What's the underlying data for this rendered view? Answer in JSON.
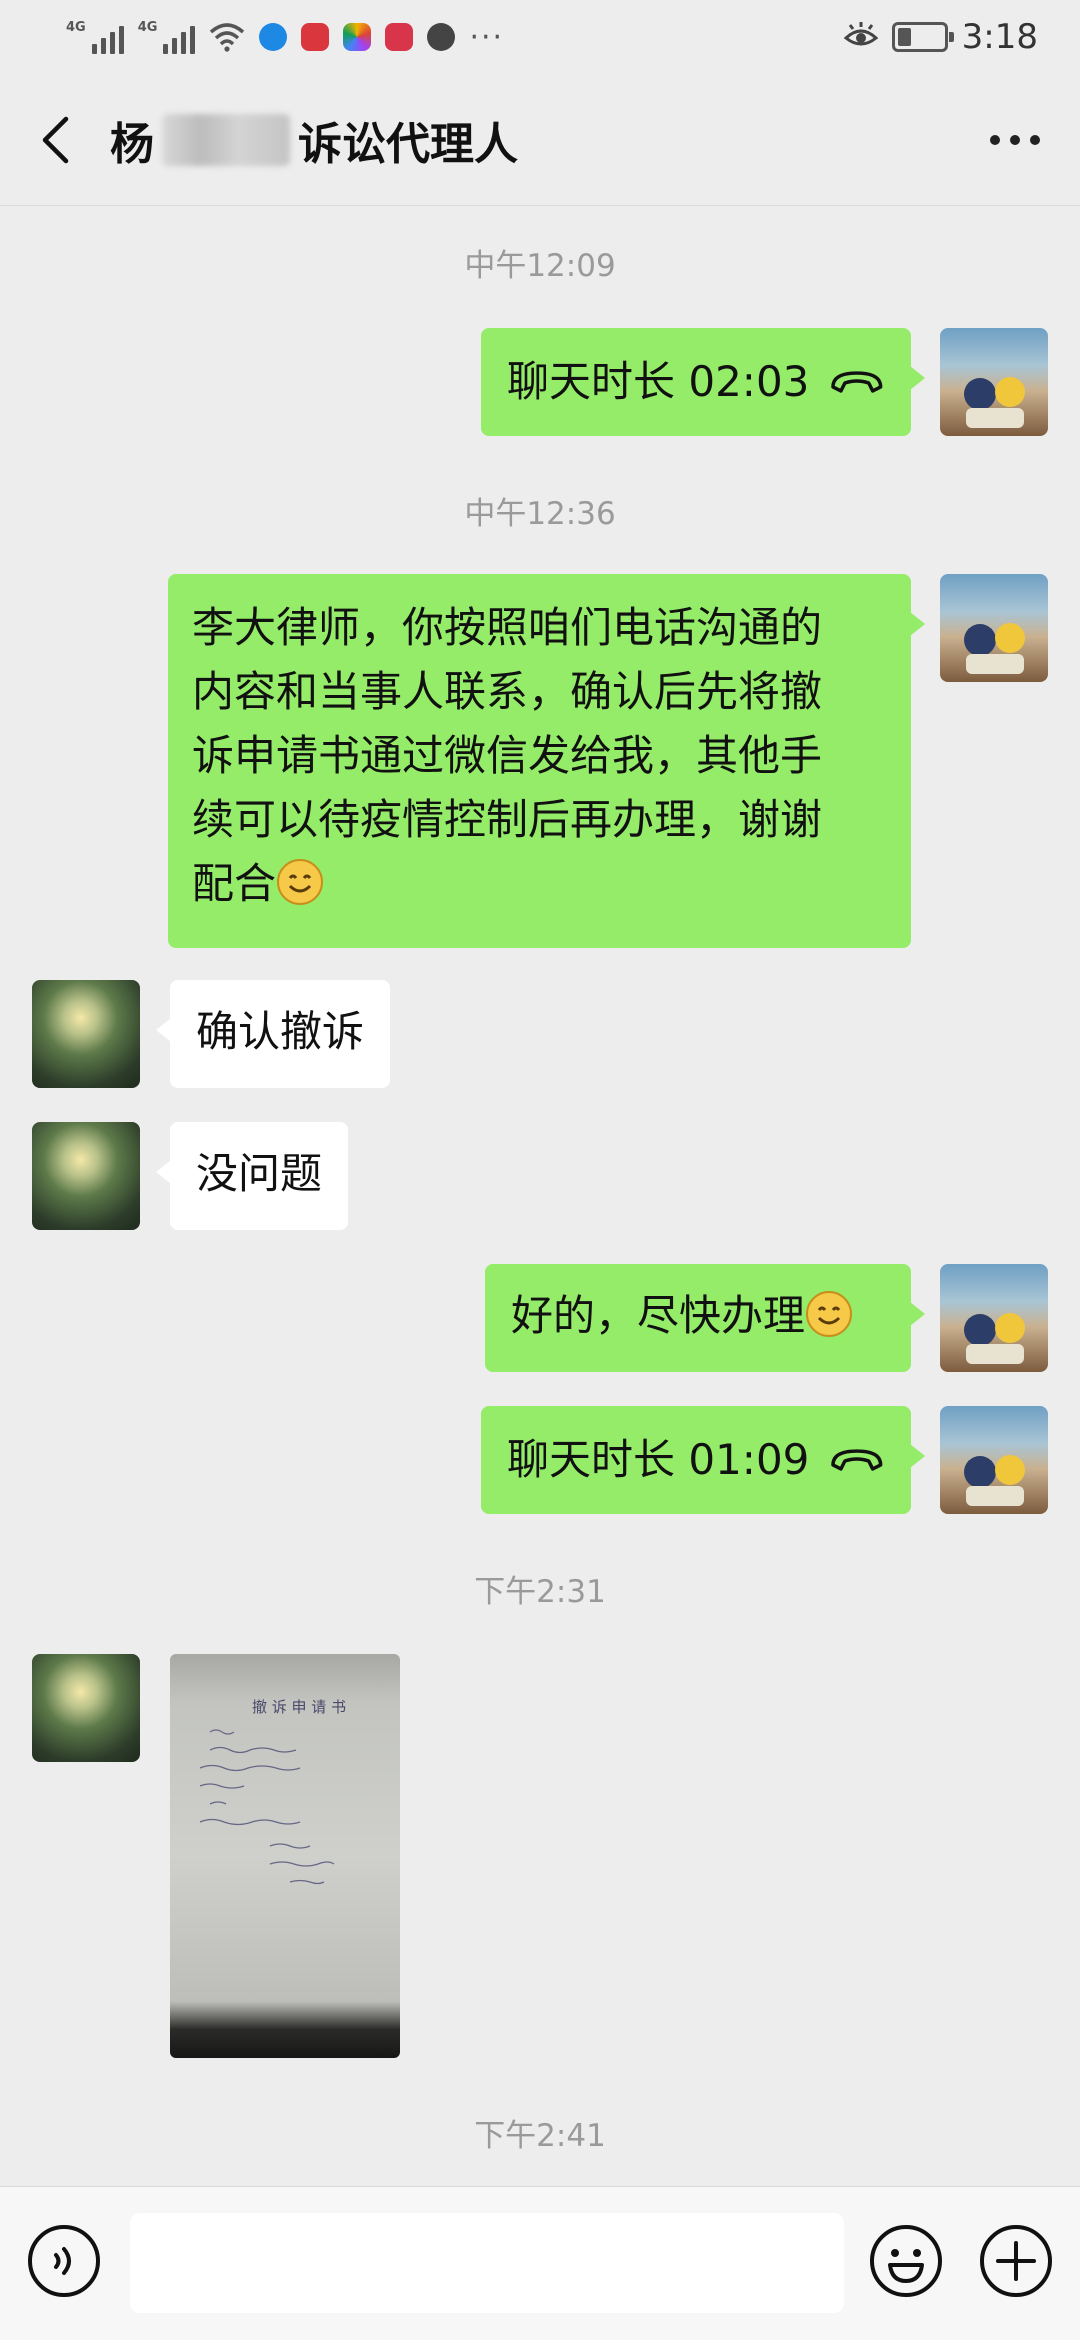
{
  "status_bar": {
    "network_1": "4G",
    "network_2": "4G",
    "more": "···",
    "time": "3:18",
    "battery_level": 0.3,
    "icons": [
      "signal-icon",
      "signal-icon",
      "wifi-icon",
      "browser-app-icon",
      "book-app-icon",
      "photos-app-icon",
      "news-app-icon",
      "audio-app-icon",
      "eye-comfort-icon",
      "battery-icon"
    ]
  },
  "header": {
    "title_prefix": "杨",
    "title_suffix": "诉讼代理人",
    "back_icon": "back-chevron-icon",
    "more_icon": "more-dots-icon"
  },
  "messages": [
    {
      "type": "timestamp",
      "text": "中午12:09"
    },
    {
      "type": "call",
      "from": "me",
      "text": "聊天时长 02:03",
      "icon": "phone-hangup-icon"
    },
    {
      "type": "timestamp",
      "text": "中午12:36"
    },
    {
      "type": "text",
      "from": "me",
      "lines": [
        "李大律师，你按照咱们电话沟通的",
        "内容和当事人联系，确认后先将撤",
        "诉申请书通过微信发给我，其他手",
        "续可以待疫情控制后再办理，谢谢",
        "配合"
      ],
      "emoji": "smile-emoji"
    },
    {
      "type": "text",
      "from": "them",
      "text": "确认撤诉"
    },
    {
      "type": "text",
      "from": "them",
      "text": "没问题"
    },
    {
      "type": "text",
      "from": "me",
      "text": "好的，尽快办理",
      "emoji": "smile-emoji"
    },
    {
      "type": "call",
      "from": "me",
      "text": "聊天时长 01:09",
      "icon": "phone-hangup-icon"
    },
    {
      "type": "timestamp",
      "text": "下午2:31"
    },
    {
      "type": "image",
      "from": "them",
      "heading": "撤 诉 申 请 书"
    },
    {
      "type": "timestamp",
      "text": "下午2:41"
    }
  ],
  "input_bar": {
    "voice_icon": "voice-input-icon",
    "emoji_icon": "emoji-picker-icon",
    "plus_icon": "plus-more-icon",
    "placeholder": ""
  },
  "colors": {
    "background": "#ededed",
    "my_bubble": "#95ec69",
    "their_bubble": "#ffffff",
    "timestamp": "#9a9a9a"
  }
}
